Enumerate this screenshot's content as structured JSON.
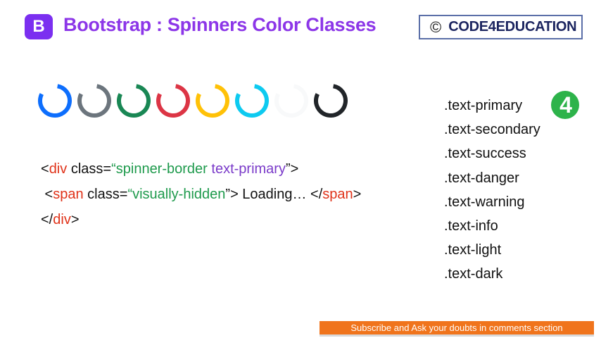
{
  "header": {
    "logo_letter": "B",
    "title": "Bootstrap : Spinners Color Classes",
    "brand_copyright": "©",
    "brand_name": "CODE4EDUCATION"
  },
  "spinners": [
    {
      "name": "primary",
      "color": "#0d6efd"
    },
    {
      "name": "secondary",
      "color": "#6c757d"
    },
    {
      "name": "success",
      "color": "#198754"
    },
    {
      "name": "danger",
      "color": "#dc3545"
    },
    {
      "name": "warning",
      "color": "#ffc107"
    },
    {
      "name": "info",
      "color": "#0dcaf0"
    },
    {
      "name": "light",
      "color": "#f8f9fa"
    },
    {
      "name": "dark",
      "color": "#212529"
    }
  ],
  "code": {
    "line1": {
      "open": "<",
      "tag": "div",
      "attr": " class=",
      "q1": "“",
      "val1": "spinner-border",
      "space": " ",
      "val2": "text-primary",
      "end": "”>"
    },
    "line2": {
      "indent": " <",
      "tag": "span",
      "attr": " class=",
      "q1": "“",
      "val": "visually-hidden",
      "mid": "”> Loading… </",
      "tag2": "span",
      "end": ">"
    },
    "line3": {
      "open": "</",
      "tag": "div",
      "end": ">"
    }
  },
  "classes": [
    ".text-primary",
    ".text-secondary",
    ".text-success",
    ".text-danger",
    ".text-warning",
    ".text-info",
    ".text-light",
    ".text-dark"
  ],
  "banner": "Subscribe and Ask your doubts in comments section"
}
